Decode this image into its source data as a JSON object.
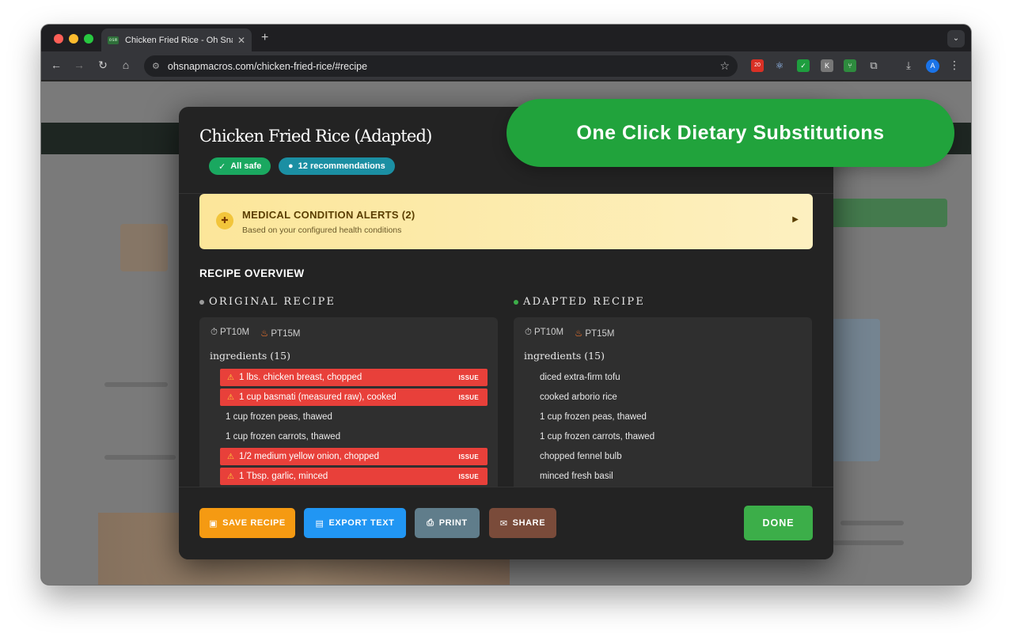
{
  "browser": {
    "tab_title": "Chicken Fried Rice - Oh Snap",
    "favicon_text": "osm",
    "url": "ohsnapmacros.com/chicken-fried-rice/#recipe",
    "ext_badge": "20",
    "avatar_letter": "A"
  },
  "modal": {
    "title": "Chicken Fried Rice (Adapted)",
    "pill_safe": "All safe",
    "pill_recommendations": "12 recommendations",
    "alert": {
      "title": "MEDICAL CONDITION ALERTS (2)",
      "subtitle": "Based on your configured health conditions"
    },
    "overview_title": "RECIPE OVERVIEW",
    "original": {
      "heading": "ORIGINAL RECIPE",
      "prep": "PT10M",
      "cook": "PT15M",
      "ingredients_label": "ingredients (15)",
      "issue_label": "ISSUE",
      "items": [
        {
          "text": "1 lbs. chicken breast, chopped",
          "issue": true
        },
        {
          "text": "1 cup  basmati (measured raw), cooked",
          "issue": true
        },
        {
          "text": "1 cup frozen peas, thawed",
          "issue": false
        },
        {
          "text": "1 cup frozen carrots, thawed",
          "issue": false
        },
        {
          "text": "1/2 medium yellow onion, chopped",
          "issue": true
        },
        {
          "text": "1 Tbsp. garlic, minced",
          "issue": true
        }
      ]
    },
    "adapted": {
      "heading": "ADAPTED RECIPE",
      "prep": "PT10M",
      "cook": "PT15M",
      "ingredients_label": "ingredients (15)",
      "items": [
        "diced extra-firm tofu",
        "cooked arborio rice",
        "1 cup frozen peas, thawed",
        "1 cup frozen carrots, thawed",
        "chopped fennel bulb",
        "minced fresh basil"
      ]
    },
    "buttons": {
      "save": "SAVE RECIPE",
      "export": "EXPORT TEXT",
      "print": "PRINT",
      "share": "SHARE",
      "done": "DONE"
    }
  },
  "banner_text": "One Click Dietary Substitutions",
  "colors": {
    "issue_red": "#e8403a",
    "safe_green": "#1aa860",
    "rec_teal": "#1b8fa3",
    "done_green": "#3cae49",
    "banner_green": "#21a33c"
  }
}
